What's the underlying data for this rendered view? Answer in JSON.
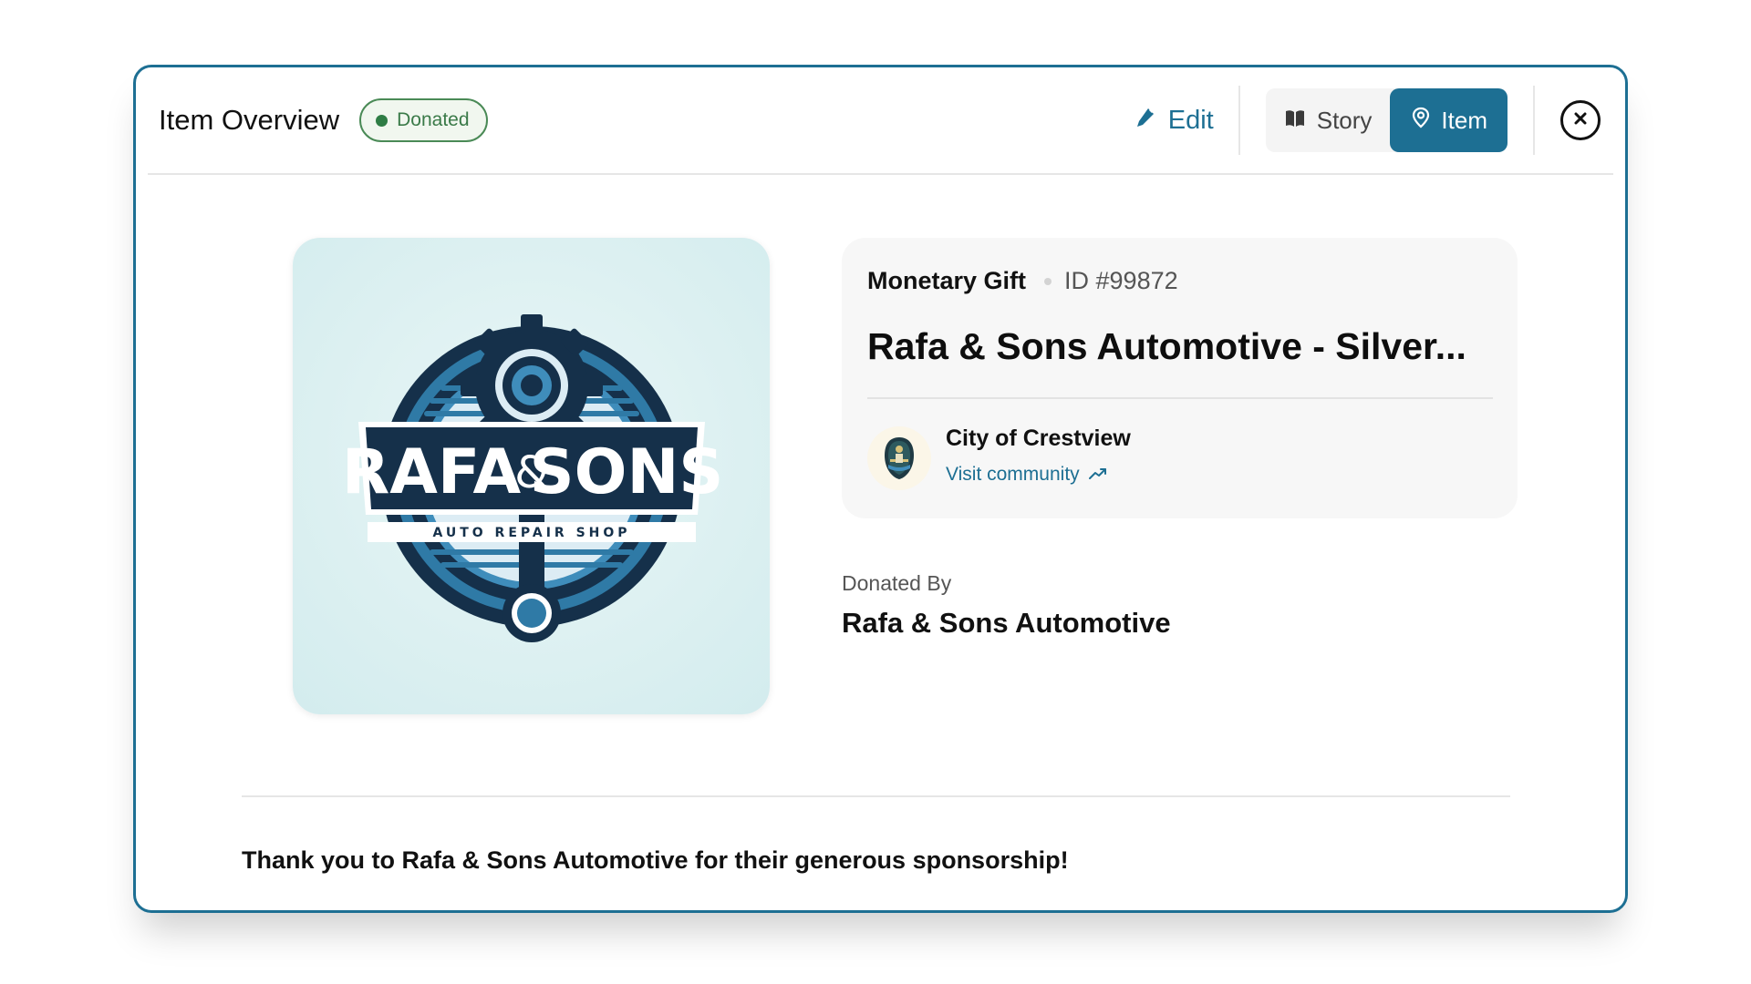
{
  "header": {
    "title": "Item Overview",
    "status_badge": "Donated",
    "edit_label": "Edit",
    "toggle": [
      {
        "label": "Story",
        "icon": "book-icon",
        "active": false
      },
      {
        "label": "Item",
        "icon": "map-pin-icon",
        "active": true
      }
    ],
    "close_icon": "close-icon"
  },
  "item": {
    "gift_type": "Monetary Gift",
    "id_label": "ID #99872",
    "name": "Rafa & Sons Automotive - Silver...",
    "image": {
      "logo_line1_left": "RAFA",
      "logo_amp": "&",
      "logo_line1_right": "SONS",
      "logo_tagline": "AUTO REPAIR SHOP"
    }
  },
  "community": {
    "name": "City of Crestview",
    "link_label": "Visit community"
  },
  "donor": {
    "label": "Donated By",
    "name": "Rafa & Sons Automotive"
  },
  "message": "Thank you to Rafa & Sons Automotive for their generous sponsorship!",
  "colors": {
    "accent": "#1d6f93",
    "badge_green": "#3a7a48",
    "logo_navy": "#15304a",
    "logo_blue": "#2f7aa6"
  }
}
